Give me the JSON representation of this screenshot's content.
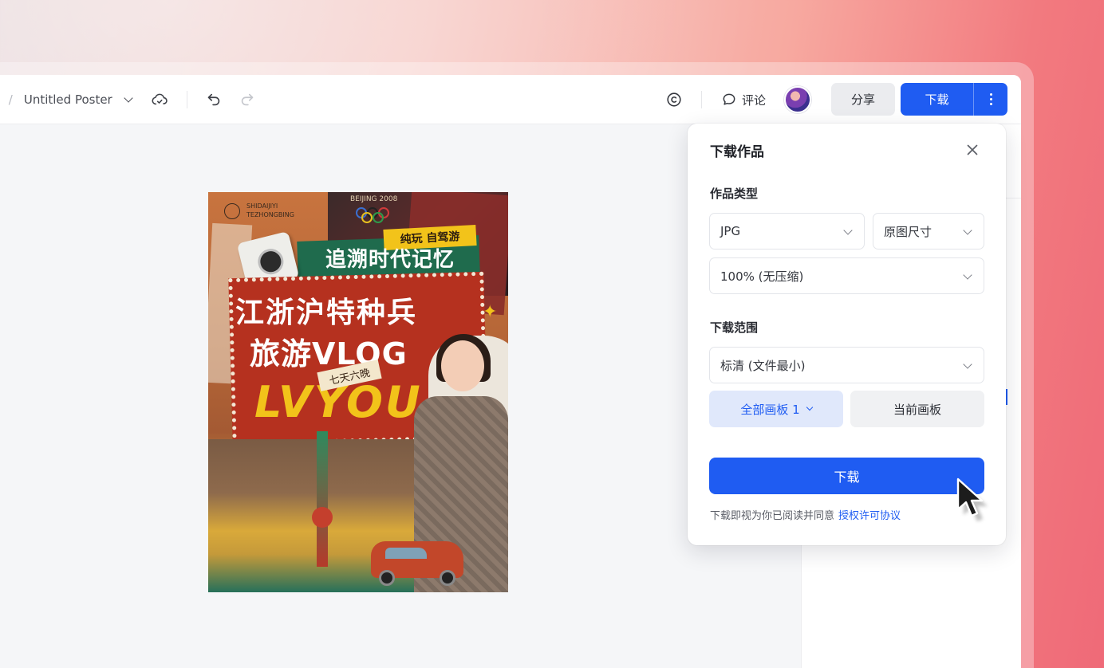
{
  "header": {
    "breadcrumb_prefix": ".",
    "breadcrumb_separator": "/",
    "document_title": "Untitled Poster",
    "comment_label": "评论",
    "share_label": "分享",
    "download_label": "下载"
  },
  "poster": {
    "brand_line1": "SHIDAIJIYI",
    "brand_line2": "TEZHONGBING",
    "beijing_text": "BEIJING 2008",
    "tag_top": "纯玩 自驾游",
    "headline1": "追溯时代记忆",
    "headline2": "江浙沪特种兵",
    "headline3": "旅游VLOG",
    "tag_small": "七天六晚",
    "lettering": "LVYOU"
  },
  "download_panel": {
    "title": "下载作品",
    "type_section_label": "作品类型",
    "format_value": "JPG",
    "size_value": "原图尺寸",
    "quality_value": "100% (无压缩)",
    "range_section_label": "下载范围",
    "resolution_value": "标清 (文件最小)",
    "all_boards_label": "全部画板 1",
    "current_board_label": "当前画板",
    "download_button_label": "下载",
    "agreement_text": "下载即视为你已阅读并同意",
    "agreement_link": "授权许可协议"
  },
  "colors": {
    "accent": "#1f5cf2",
    "accent_light": "#e0e8fb",
    "background_gradient_end": "#ef6a78"
  },
  "icons": [
    "chevron-down-icon",
    "cloud-sync-icon",
    "undo-icon",
    "redo-icon",
    "copyright-icon",
    "comment-icon",
    "more-vertical-icon",
    "close-icon",
    "cursor-icon"
  ]
}
